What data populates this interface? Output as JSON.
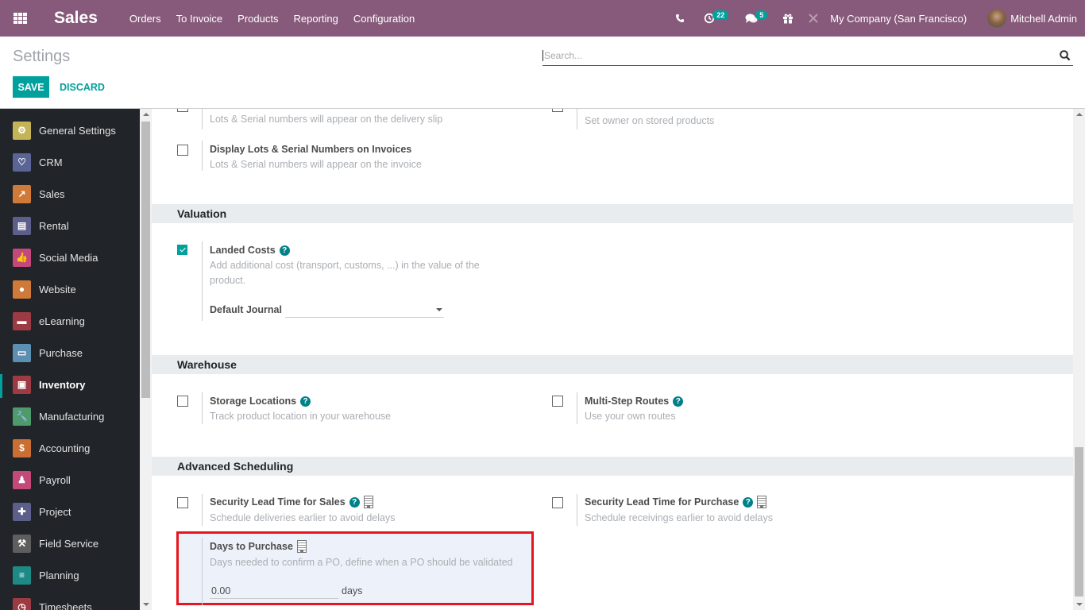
{
  "navbar": {
    "app_name": "Sales",
    "menu": [
      "Orders",
      "To Invoice",
      "Products",
      "Reporting",
      "Configuration"
    ],
    "systray": {
      "phone_icon": "phone-icon",
      "activity_icon": "clock-icon",
      "activity_count": "22",
      "messages_icon": "chat-icon",
      "messages_count": "5",
      "gift_icon": "gift-icon",
      "debug_icon": "tools-icon",
      "company": "My Company (San Francisco)",
      "user": "Mitchell Admin"
    }
  },
  "control_panel": {
    "title": "Settings",
    "save_label": "SAVE",
    "discard_label": "DISCARD",
    "search_placeholder": "Search..."
  },
  "sidebar": {
    "items": [
      {
        "label": "General Settings",
        "icon": "gear-icon",
        "color": "#c5b358"
      },
      {
        "label": "CRM",
        "icon": "handshake-icon",
        "color": "#5b6595"
      },
      {
        "label": "Sales",
        "icon": "chart-icon",
        "color": "#d07a3a"
      },
      {
        "label": "Rental",
        "icon": "rental-icon",
        "color": "#5c5f8a"
      },
      {
        "label": "Social Media",
        "icon": "thumbs-up-icon",
        "color": "#c4497a"
      },
      {
        "label": "Website",
        "icon": "globe-icon",
        "color": "#d07a3a"
      },
      {
        "label": "eLearning",
        "icon": "elearning-icon",
        "color": "#9c3b43"
      },
      {
        "label": "Purchase",
        "icon": "credit-card-icon",
        "color": "#5d8fb3"
      },
      {
        "label": "Inventory",
        "icon": "box-icon",
        "color": "#9c3b43",
        "active": true
      },
      {
        "label": "Manufacturing",
        "icon": "wrench-icon",
        "color": "#4e9a6a"
      },
      {
        "label": "Accounting",
        "icon": "invoice-icon",
        "color": "#c96f34"
      },
      {
        "label": "Payroll",
        "icon": "payroll-icon",
        "color": "#c4497a"
      },
      {
        "label": "Project",
        "icon": "puzzle-icon",
        "color": "#5c5f8a"
      },
      {
        "label": "Field Service",
        "icon": "field-service-icon",
        "color": "#5e5e5e"
      },
      {
        "label": "Planning",
        "icon": "planning-icon",
        "color": "#1e8a86"
      },
      {
        "label": "Timesheets",
        "icon": "stopwatch-icon",
        "color": "#9c3b43"
      }
    ]
  },
  "content": {
    "top_left": {
      "desc": "Lots & Serial numbers will appear on the delivery slip",
      "checked": false
    },
    "top_right": {
      "desc": "Set owner on stored products",
      "checked": false
    },
    "lots_invoices": {
      "title": "Display Lots & Serial Numbers on Invoices",
      "desc": "Lots & Serial numbers will appear on the invoice",
      "checked": false
    },
    "valuation": {
      "header": "Valuation",
      "landed_costs": {
        "title": "Landed Costs",
        "desc": "Add additional cost (transport, customs, ...) in the value of the product.",
        "checked": true,
        "journal_label": "Default Journal",
        "journal_value": ""
      }
    },
    "warehouse": {
      "header": "Warehouse",
      "storage": {
        "title": "Storage Locations",
        "desc": "Track product location in your warehouse",
        "checked": false
      },
      "routes": {
        "title": "Multi-Step Routes",
        "desc": "Use your own routes",
        "checked": false
      }
    },
    "scheduling": {
      "header": "Advanced Scheduling",
      "lead_sales": {
        "title": "Security Lead Time for Sales",
        "desc": "Schedule deliveries earlier to avoid delays",
        "checked": false
      },
      "lead_purchase": {
        "title": "Security Lead Time for Purchase",
        "desc": "Schedule receivings earlier to avoid delays",
        "checked": false
      },
      "days_purchase": {
        "title": "Days to Purchase",
        "desc": "Days needed to confirm a PO, define when a PO should be validated",
        "value": "0.00",
        "unit": "days"
      }
    }
  },
  "colors": {
    "brand": "#875a7b",
    "accent": "#00a09d",
    "highlight_border": "#e8141e"
  }
}
